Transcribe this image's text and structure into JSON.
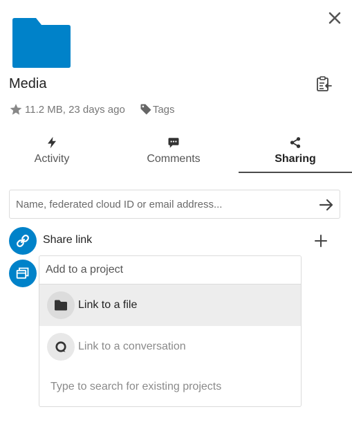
{
  "header": {
    "title": "Media",
    "size_age": "11.2 MB, 23 days ago",
    "tags_label": "Tags"
  },
  "icons": {
    "folder": "folder-icon",
    "close": "close-icon",
    "clipboard": "clipboard-icon",
    "star": "star-icon",
    "tag": "tag-icon",
    "activity": "lightning-icon",
    "comments": "comment-icon",
    "sharing": "share-icon",
    "submit": "arrow-right-icon",
    "link": "link-icon",
    "add": "plus-icon",
    "project": "projects-icon",
    "file": "folder-icon",
    "conversation": "talk-icon"
  },
  "colors": {
    "brand": "#0082c9",
    "text": "#222222",
    "muted": "#767676",
    "highlight": "#ededed",
    "border": "#dbdbdb"
  },
  "tabs": [
    {
      "label": "Activity",
      "active": false
    },
    {
      "label": "Comments",
      "active": false
    },
    {
      "label": "Sharing",
      "active": true
    }
  ],
  "sharing": {
    "search_placeholder": "Name, federated cloud ID or email address...",
    "share_link_label": "Share link"
  },
  "projects": {
    "input_placeholder": "Add to a project",
    "options": [
      {
        "label": "Link to a file",
        "highlighted": true
      },
      {
        "label": "Link to a conversation",
        "highlighted": false
      }
    ],
    "search_hint": "Type to search for existing projects"
  }
}
